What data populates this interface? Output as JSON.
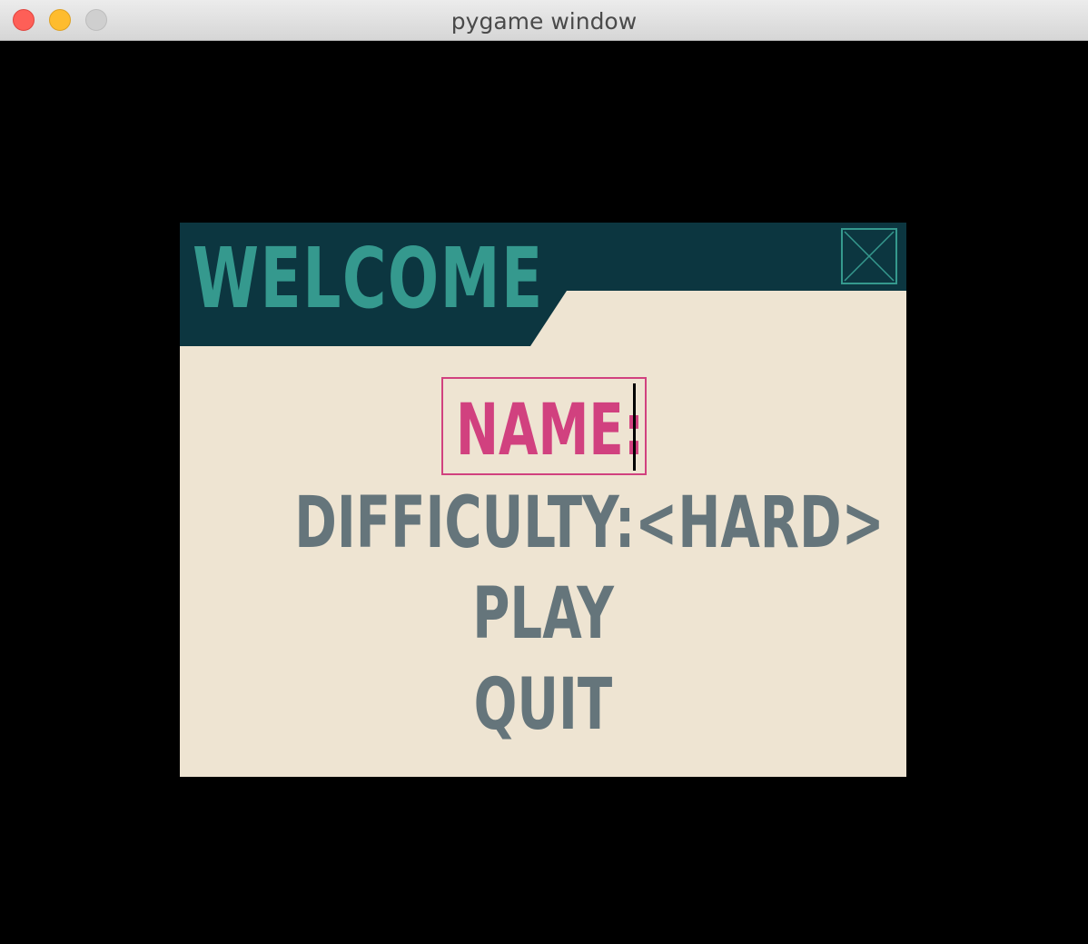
{
  "window": {
    "title": "pygame window"
  },
  "dialog": {
    "heading": "WELCOME",
    "name_label": "NAME:",
    "difficulty_label": "DIFFICULTY:<HARD>",
    "play_label": "PLAY",
    "quit_label": "QUIT",
    "close_icon": "close-x-icon"
  },
  "colors": {
    "header_bg": "#0c3640",
    "accent_teal": "#35998e",
    "panel_bg": "#eee4d2",
    "menu_text": "#65757b",
    "selected": "#d1417f"
  }
}
